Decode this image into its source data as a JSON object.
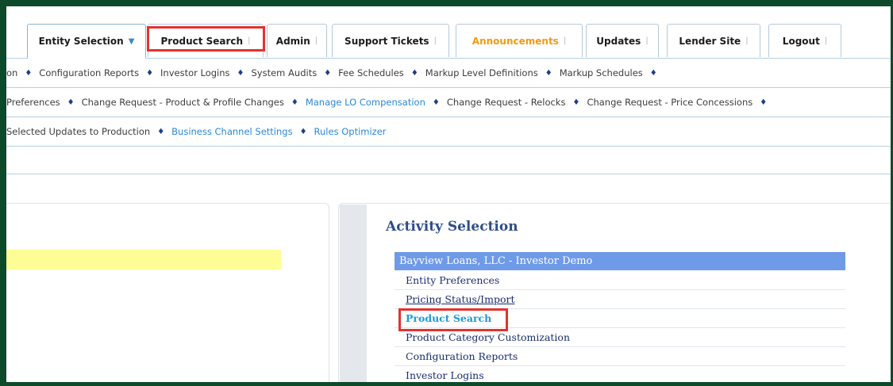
{
  "tabs": [
    {
      "label": "Entity Selection",
      "caret": "▼"
    },
    {
      "label": "Product Search"
    },
    {
      "label": "Admin"
    },
    {
      "label": "Support Tickets"
    },
    {
      "label": "Announcements"
    },
    {
      "label": "Updates"
    },
    {
      "label": "Lender Site"
    },
    {
      "label": "Logout"
    }
  ],
  "tab_separator": "|",
  "nav_row_1": [
    "on",
    "Configuration Reports",
    "Investor Logins",
    "System Audits",
    "Fee Schedules",
    "Markup Level Definitions",
    "Markup Schedules"
  ],
  "nav_row_2": [
    "Preferences",
    "Change Request - Product & Profile Changes",
    "Manage LO Compensation",
    "Change Request - Relocks",
    "Change Request - Price Concessions"
  ],
  "nav_row_3": [
    "Selected Updates to Production",
    "Business Channel Settings",
    "Rules Optimizer"
  ],
  "diamond": "♦",
  "activity": {
    "title": "Activity Selection",
    "header": "Bayview Loans, LLC - Investor Demo",
    "items": [
      "Entity Preferences",
      "Pricing Status/Import",
      "Product Search",
      "Product Category Customization",
      "Configuration Reports",
      "Investor Logins"
    ]
  },
  "colors": {
    "accent": "#2b88d8",
    "highlight": "#e4322d",
    "announcement": "#f59a0e",
    "header_bar": "#6f9ae8",
    "frame": "#0c4a2a"
  }
}
